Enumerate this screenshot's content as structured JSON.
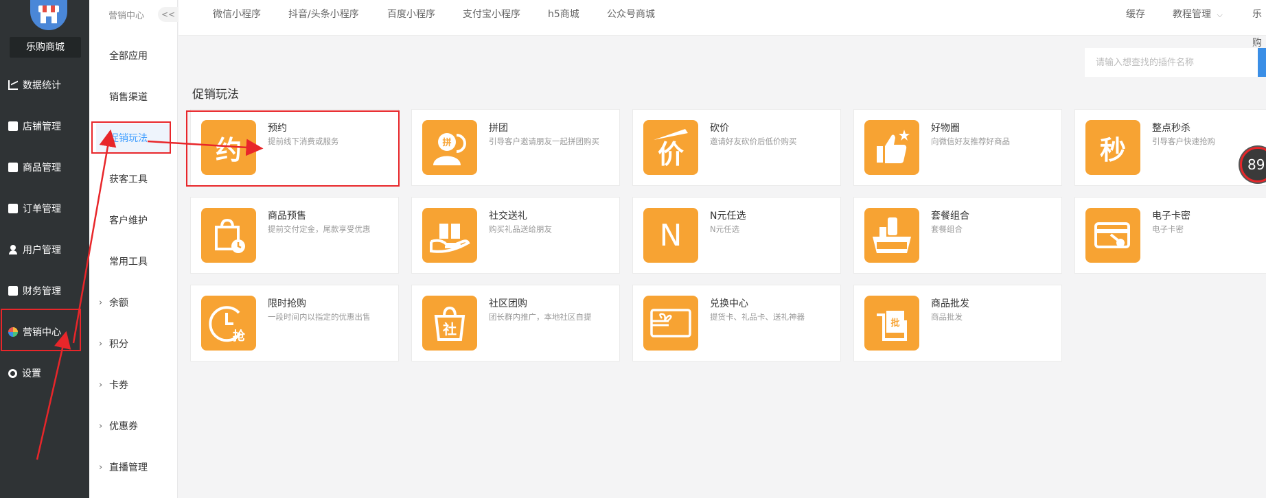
{
  "store": {
    "name": "乐购商城"
  },
  "main_nav": [
    {
      "label": "数据统计",
      "icon": "chart-icon"
    },
    {
      "label": "店铺管理",
      "icon": "store-icon"
    },
    {
      "label": "商品管理",
      "icon": "goods-icon"
    },
    {
      "label": "订单管理",
      "icon": "order-icon"
    },
    {
      "label": "用户管理",
      "icon": "user-icon"
    },
    {
      "label": "财务管理",
      "icon": "finance-icon"
    },
    {
      "label": "营销中心",
      "icon": "marketing-icon"
    },
    {
      "label": "设置",
      "icon": "settings-icon"
    }
  ],
  "sub_nav": {
    "title": "营销中心",
    "collapse_label": "<<",
    "items": [
      {
        "label": "全部应用"
      },
      {
        "label": "销售渠道"
      },
      {
        "label": "促销玩法"
      },
      {
        "label": "获客工具"
      },
      {
        "label": "客户维护"
      },
      {
        "label": "常用工具"
      },
      {
        "label": "余额"
      },
      {
        "label": "积分"
      },
      {
        "label": "卡券"
      },
      {
        "label": "优惠券"
      },
      {
        "label": "直播管理"
      }
    ],
    "active": "促销玩法"
  },
  "top_tabs": [
    "微信小程序",
    "抖音/头条小程序",
    "百度小程序",
    "支付宝小程序",
    "h5商城",
    "公众号商城"
  ],
  "top_right": {
    "cache": "缓存",
    "tutorial": "教程管理",
    "user": "乐购"
  },
  "search": {
    "placeholder": "请输入想查找的插件名称"
  },
  "section": {
    "title": "促销玩法"
  },
  "cards": [
    {
      "title": "预约",
      "desc": "提前线下消费或服务",
      "icon": "appointment-icon",
      "glyph": "约"
    },
    {
      "title": "拼团",
      "desc": "引导客户邀请朋友一起拼团购买",
      "icon": "group-buy-icon",
      "glyph": "拼"
    },
    {
      "title": "砍价",
      "desc": "邀请好友砍价后低价购买",
      "icon": "bargain-icon",
      "glyph": "价"
    },
    {
      "title": "好物圈",
      "desc": "向微信好友推荐好商品",
      "icon": "thumbs-up-icon",
      "glyph": ""
    },
    {
      "title": "整点秒杀",
      "desc": "引导客户快速抢购",
      "icon": "flash-sale-icon",
      "glyph": "秒"
    },
    {
      "title": "商品预售",
      "desc": "提前交付定金，尾款享受优惠",
      "icon": "presale-bag-icon",
      "glyph": ""
    },
    {
      "title": "社交送礼",
      "desc": "购买礼品送给朋友",
      "icon": "gift-icon",
      "glyph": ""
    },
    {
      "title": "N元任选",
      "desc": "N元任选",
      "icon": "n-choice-icon",
      "glyph": "N"
    },
    {
      "title": "套餐组合",
      "desc": "套餐组合",
      "icon": "combo-icon",
      "glyph": ""
    },
    {
      "title": "电子卡密",
      "desc": "电子卡密",
      "icon": "card-key-icon",
      "glyph": ""
    },
    {
      "title": "限时抢购",
      "desc": "一段时间内以指定的优惠出售",
      "icon": "clock-rush-icon",
      "glyph": "抢"
    },
    {
      "title": "社区团购",
      "desc": "团长群内推广，本地社区自提",
      "icon": "community-bag-icon",
      "glyph": "社"
    },
    {
      "title": "兑换中心",
      "desc": "提货卡、礼品卡、送礼神器",
      "icon": "gift-card-icon",
      "glyph": ""
    },
    {
      "title": "商品批发",
      "desc": "商品批发",
      "icon": "wholesale-icon",
      "glyph": "批"
    }
  ],
  "badge": {
    "text": "89"
  },
  "colors": {
    "sidebar": "#2f3335",
    "accent": "#409eff",
    "icon_orange": "#f7a333",
    "annotation_red": "#e8262a"
  }
}
